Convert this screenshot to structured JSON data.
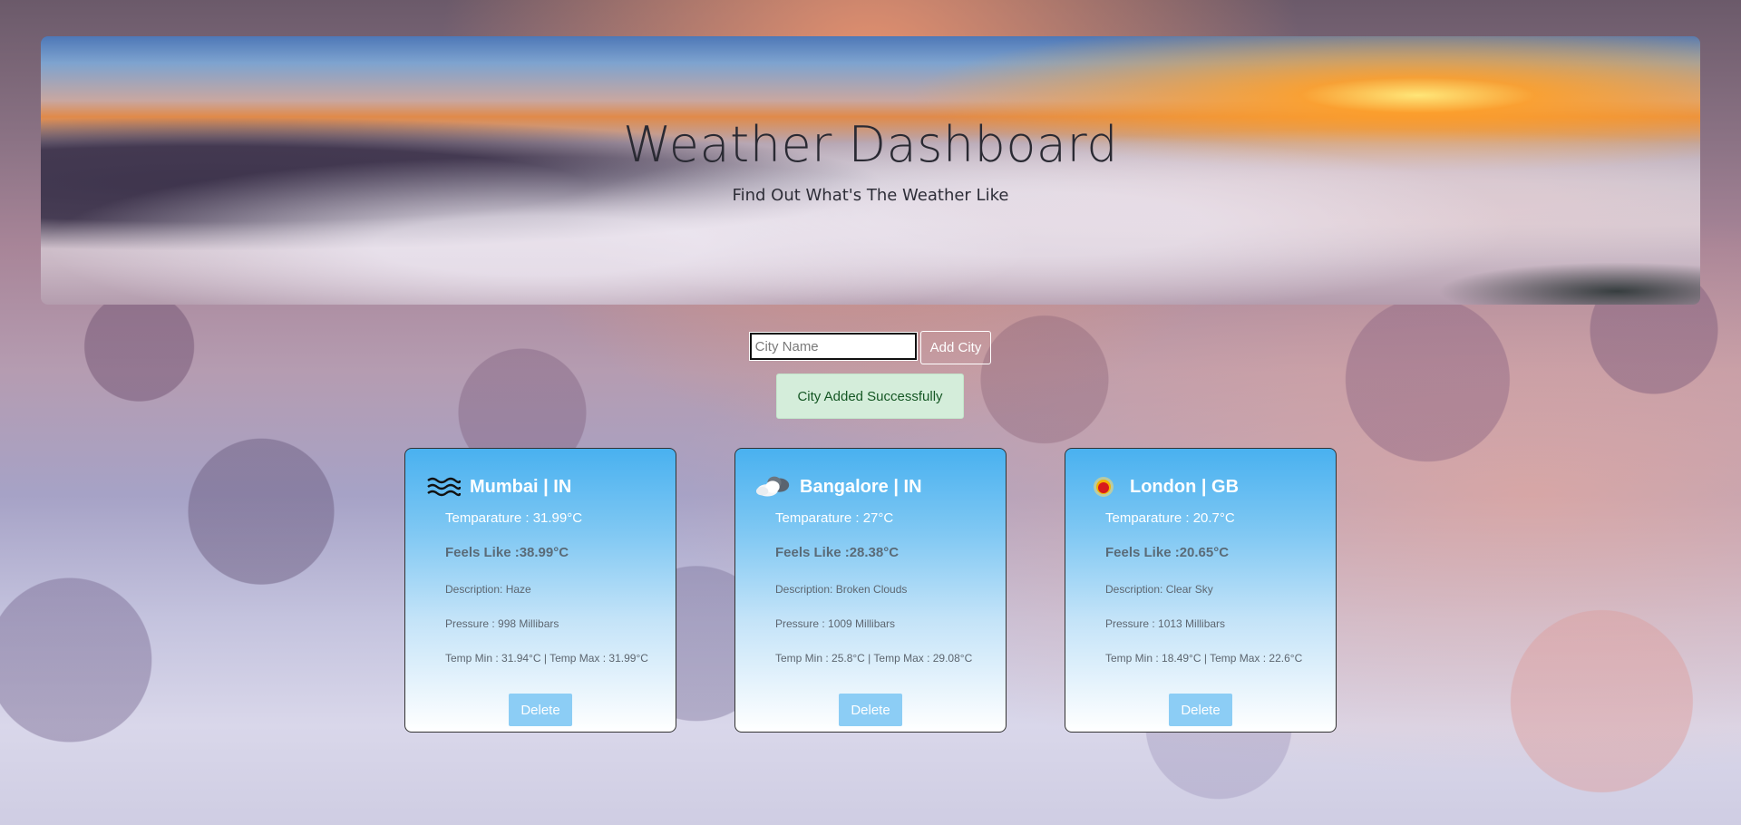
{
  "header": {
    "title": "Weather Dashboard",
    "subtitle": "Find Out What's The Weather Like"
  },
  "form": {
    "placeholder": "City Name",
    "value": "",
    "add_label": "Add City"
  },
  "alert": {
    "message": "City Added Successfully",
    "color": "#d4edda"
  },
  "cards": [
    {
      "icon": "haze-icon",
      "title": "Mumbai | IN",
      "temperature": "Temparature : 31.99°C",
      "feels_like": "Feels Like :38.99°C",
      "description": "Description: Haze",
      "pressure": "Pressure : 998 Millibars",
      "temp_range": "Temp Min : 31.94°C | Temp Max : 31.99°C",
      "delete_label": "Delete"
    },
    {
      "icon": "broken-clouds-icon",
      "title": "Bangalore | IN",
      "temperature": "Temparature : 27°C",
      "feels_like": "Feels Like :28.38°C",
      "description": "Description: Broken Clouds",
      "pressure": "Pressure : 1009 Millibars",
      "temp_range": "Temp Min : 25.8°C | Temp Max : 29.08°C",
      "delete_label": "Delete"
    },
    {
      "icon": "clear-sky-icon",
      "title": "London | GB",
      "temperature": "Temparature : 20.7°C",
      "feels_like": "Feels Like :20.65°C",
      "description": "Description: Clear Sky",
      "pressure": "Pressure : 1013 Millibars",
      "temp_range": "Temp Min : 18.49°C | Temp Max : 22.6°C",
      "delete_label": "Delete"
    }
  ],
  "colors": {
    "card_top": "#49b1f0",
    "delete_button": "#8ccdf5"
  }
}
